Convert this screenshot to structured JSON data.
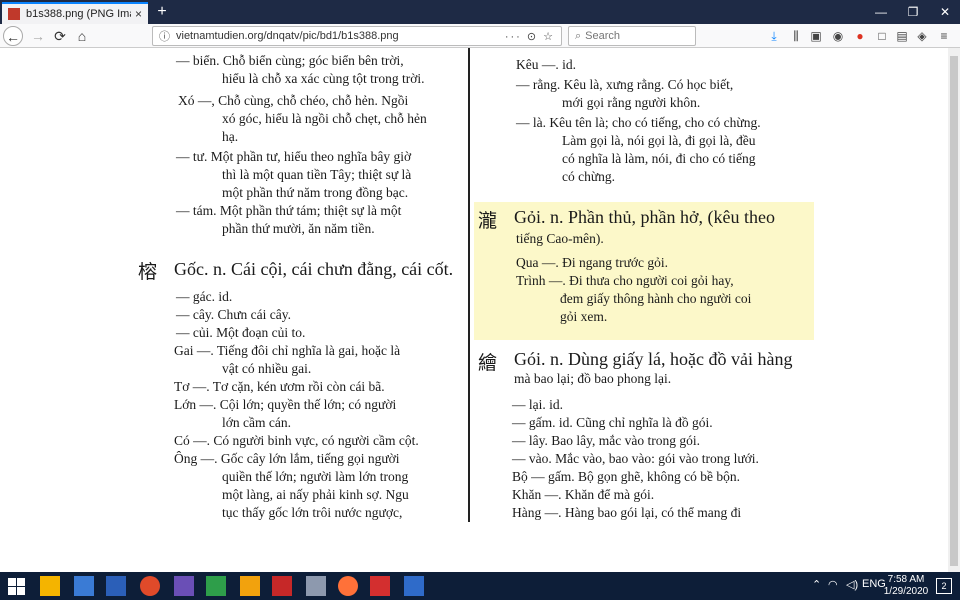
{
  "browser": {
    "tab_title": "b1s388.png (PNG Image, 1323...",
    "tab_close": "×",
    "new_tab": "+",
    "url": "vietnamtudien.org/dnqatv/pic/bd1/b1s388.png",
    "url_actions": "··· ⊙ ☆",
    "search_placeholder": "Search",
    "accent_color": "#0a84ff",
    "titlebar_color": "#1e2a45"
  },
  "page": {
    "left_column": [
      {
        "text": "— biển. Chỗ biển cùng; góc biển bên trời,"
      },
      {
        "text": "hiểu là chỗ xa xác cùng tột trong trời."
      },
      {
        "text": "Xó —, Chỗ cùng, chỗ chéo, chỗ hẻn. Ngồi"
      },
      {
        "text": "xó góc, hiểu là ngồi chỗ chẹt, chỗ hẻn"
      },
      {
        "text": "hạ."
      },
      {
        "text": "— tư. Một phần tư, hiểu theo nghĩa bây giờ"
      },
      {
        "text": "thì là một quan tiền Tây; thiệt sự là"
      },
      {
        "text": "một phần thứ năm trong đồng bạc."
      },
      {
        "text": "— tám. Một phần thứ tám; thiệt sự là một"
      },
      {
        "text": "phần thứ mười, ăn năm tiền."
      },
      {
        "text": "Gốc. n. Cái cội, cái chưn đằng, cái cốt."
      },
      {
        "text": "— gác.          id."
      },
      {
        "text": "— cây. Chưn cái cây."
      },
      {
        "text": "— củi. Một đoạn củi to."
      },
      {
        "text": "Gai —. Tiếng đôi chỉ nghĩa là gai, hoặc là"
      },
      {
        "text": "vật có nhiều gai."
      },
      {
        "text": "Tơ —. Tơ cặn, kén ươm rồi còn cái bã."
      },
      {
        "text": "Lớn —. Cội lớn; quyền thế lớn; có người"
      },
      {
        "text": "lớn cầm cán."
      },
      {
        "text": "Có —. Có người binh vực, có người cầm cột."
      },
      {
        "text": "Ông —. Gốc cây lớn lắm, tiếng gọi người"
      },
      {
        "text": "quiền thế lớn; người làm lớn trong"
      },
      {
        "text": "một làng, ai nấy phải kinh sợ. Ngu"
      },
      {
        "text": "tục thấy gốc lớn trôi nước ngược,"
      }
    ],
    "right_column": [
      {
        "text": "Kêu —.          id."
      },
      {
        "text": "— rằng. Kêu là, xưng rằng. Có học biết,"
      },
      {
        "text": "mới gọi rằng người khôn."
      },
      {
        "text": "— là. Kêu tên là; cho có tiếng, cho có chừng."
      },
      {
        "text": "Làm gọi là, nói gọi là, đi gọi là, đều"
      },
      {
        "text": "có nghĩa là làm, nói, đi cho có tiếng"
      },
      {
        "text": "có chừng."
      },
      {
        "text": "Gỏi. n. Phần thủ, phần hở, (kêu theo"
      },
      {
        "text": "tiếng Cao-mên)."
      },
      {
        "text": "Qua —. Đi ngang trước gỏi."
      },
      {
        "text": "Trình —. Đi thưa cho người coi gỏi hay,"
      },
      {
        "text": "đem giấy thông hành cho người coi"
      },
      {
        "text": "gỏi xem."
      },
      {
        "text": "Gói. n. Dùng giấy lá, hoặc đồ vải hàng"
      },
      {
        "text": "mà bao lại; đồ bao phong lại."
      },
      {
        "text": "— lại.          id."
      },
      {
        "text": "— gấm.     id. Cũng chỉ nghĩa là đồ gói."
      },
      {
        "text": "— lây. Bao lây, mắc vào trong gói."
      },
      {
        "text": "— vào. Mắc vào, bao vào: gói vào trong lưới."
      },
      {
        "text": "Bộ — gấm. Bộ gọn ghẽ, không có bề bộn."
      },
      {
        "text": "Khăn —. Khăn để mà gói."
      },
      {
        "text": "Hàng —. Hàng bao gói lại, có thể mang đi"
      }
    ],
    "han_chars": {
      "goc": "榕",
      "goi1": "瀧",
      "goi2": "繪"
    },
    "highlight_color": "#fcf8c9"
  },
  "taskbar": {
    "time": "7:58 AM",
    "date": "1/29/2020",
    "lang": "ENG",
    "notifications": "2"
  }
}
